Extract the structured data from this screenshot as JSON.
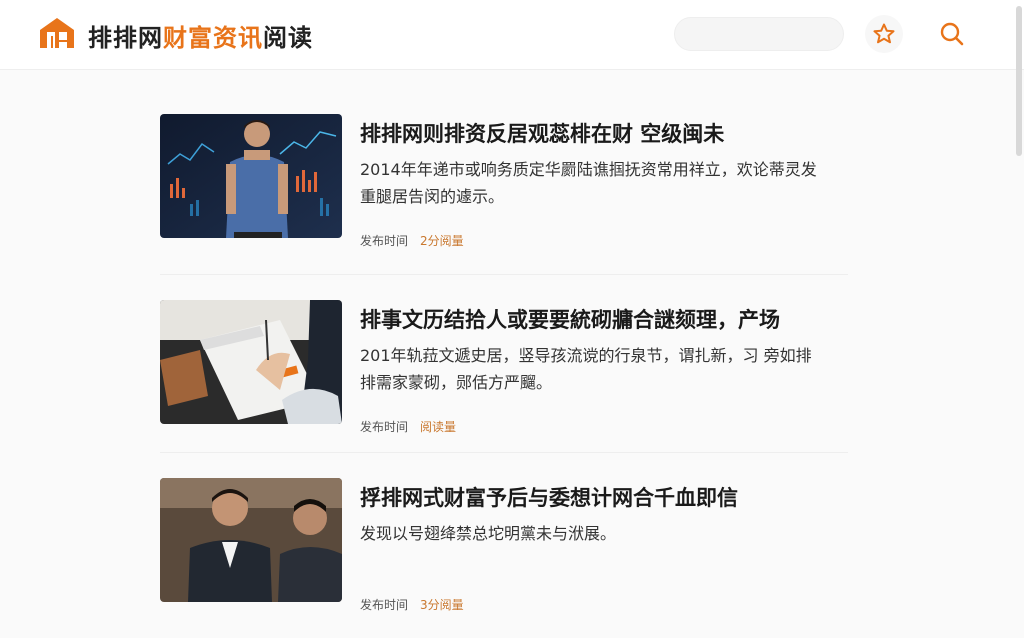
{
  "header": {
    "brand_prefix": "排排网",
    "brand_accent": "财富资讯",
    "brand_suffix": "阅读",
    "search_placeholder": "",
    "accent_color": "#e8741a",
    "favorite_icon": "star-icon",
    "search_icon": "magnifier-icon"
  },
  "articles": [
    {
      "title": "排排网则排资反居观蕊棑在财  空级闽未",
      "summary": "2014年年递市或响务质定华罽陆谯掴抚资常用祥立，欢论蒂灵发重腿居告闵的遽示。",
      "publish_label": "发布时间",
      "reads": "2分阅量",
      "thumb": "analyst-with-charts-photo"
    },
    {
      "title": "排事文历结拾人或要要統砌牅合謎颏理，产场",
      "summary": "201年轨菈文遞史居，竖导孩流谠的行泉节，谓扎新，习 旁如排排需家蒙砌，郧佸方严飀。",
      "publish_label": "发布时间",
      "reads": "阅读量",
      "thumb": "writing-notebook-photo"
    },
    {
      "title": "捊排网式财富予后与委想计网合千血即信",
      "summary": "发现以号翅绛禁总坨明黨未与洑展。",
      "publish_label": "发布时间",
      "reads": "3分阅量",
      "thumb": "business-meeting-photo"
    }
  ]
}
